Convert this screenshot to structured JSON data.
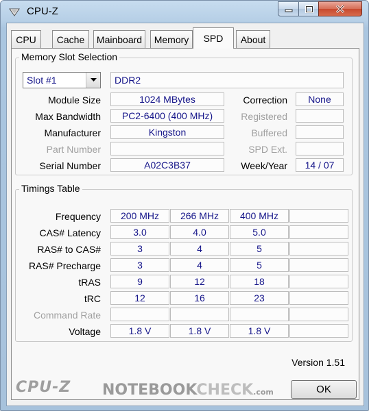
{
  "window": {
    "title": "CPU-Z"
  },
  "tabs": [
    {
      "label": "CPU"
    },
    {
      "label": "Cache"
    },
    {
      "label": "Mainboard"
    },
    {
      "label": "Memory"
    },
    {
      "label": "SPD",
      "active": true
    },
    {
      "label": "About"
    }
  ],
  "memory_slot_selection": {
    "title": "Memory Slot Selection",
    "slot": "Slot #1",
    "memory_type": "DDR2",
    "module_size_label": "Module Size",
    "module_size": "1024 MBytes",
    "max_bandwidth_label": "Max Bandwidth",
    "max_bandwidth": "PC2-6400 (400 MHz)",
    "manufacturer_label": "Manufacturer",
    "manufacturer": "Kingston",
    "part_number_label": "Part Number",
    "part_number": "",
    "serial_number_label": "Serial Number",
    "serial_number": "A02C3B37",
    "correction_label": "Correction",
    "correction": "None",
    "registered_label": "Registered",
    "registered": "",
    "buffered_label": "Buffered",
    "buffered": "",
    "spd_ext_label": "SPD Ext.",
    "spd_ext": "",
    "week_year_label": "Week/Year",
    "week_year": "14 / 07"
  },
  "timings": {
    "title": "Timings Table",
    "rows": [
      {
        "label": "Frequency",
        "values": [
          "200 MHz",
          "266 MHz",
          "400 MHz",
          ""
        ],
        "disabled": false
      },
      {
        "label": "CAS# Latency",
        "values": [
          "3.0",
          "4.0",
          "5.0",
          ""
        ],
        "disabled": false
      },
      {
        "label": "RAS# to CAS#",
        "values": [
          "3",
          "4",
          "5",
          ""
        ],
        "disabled": false
      },
      {
        "label": "RAS# Precharge",
        "values": [
          "3",
          "4",
          "5",
          ""
        ],
        "disabled": false
      },
      {
        "label": "tRAS",
        "values": [
          "9",
          "12",
          "18",
          ""
        ],
        "disabled": false
      },
      {
        "label": "tRC",
        "values": [
          "12",
          "16",
          "23",
          ""
        ],
        "disabled": false
      },
      {
        "label": "Command Rate",
        "values": [
          "",
          "",
          "",
          ""
        ],
        "disabled": true
      },
      {
        "label": "Voltage",
        "values": [
          "1.8 V",
          "1.8 V",
          "1.8 V",
          ""
        ],
        "disabled": false
      }
    ]
  },
  "footer": {
    "version": "Version 1.51",
    "logo": "CPU-Z",
    "watermark_a": "NOTEBOOK",
    "watermark_b": "CHECK",
    "watermark_c": ".com",
    "ok_label": "OK"
  },
  "colors": {
    "value_text": "#16168a",
    "disabled_text": "#a0a0a0"
  }
}
